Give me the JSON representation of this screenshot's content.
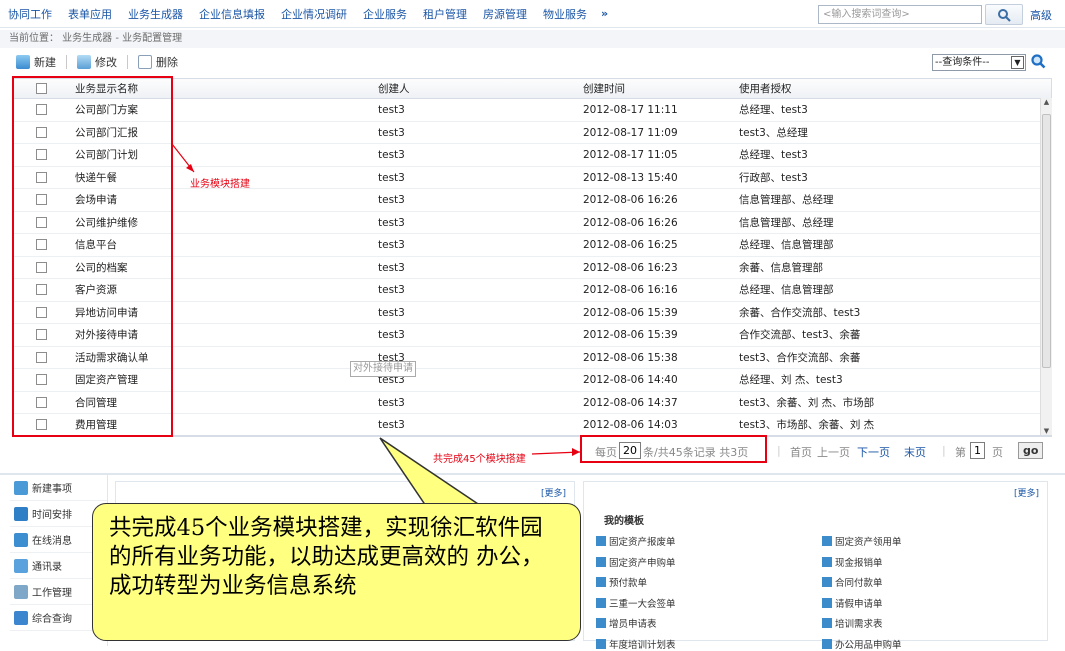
{
  "topnav": {
    "items": [
      "协同工作",
      "表单应用",
      "业务生成器",
      "企业信息填报",
      "企业情况调研",
      "企业服务",
      "租户管理",
      "房源管理",
      "物业服务"
    ],
    "more": "»",
    "search_placeholder": "<输入搜索词查询>",
    "advanced": "高级"
  },
  "breadcrumb": "当前位置： 业务生成器 - 业务配置管理",
  "toolbar": {
    "new": "新建",
    "edit": "修改",
    "delete": "删除",
    "query_select": "--查询条件--"
  },
  "grid": {
    "columns": [
      "业务显示名称",
      "创建人",
      "创建时间",
      "使用者授权"
    ],
    "rows": [
      [
        "公司部门方案",
        "test3",
        "2012-08-17 11:11",
        "总经理、test3"
      ],
      [
        "公司部门汇报",
        "test3",
        "2012-08-17 11:09",
        "test3、总经理"
      ],
      [
        "公司部门计划",
        "test3",
        "2012-08-17 11:05",
        "总经理、test3"
      ],
      [
        "快递午餐",
        "test3",
        "2012-08-13 15:40",
        "行政部、test3"
      ],
      [
        "会场申请",
        "test3",
        "2012-08-06 16:26",
        "信息管理部、总经理"
      ],
      [
        "公司维护维修",
        "test3",
        "2012-08-06 16:26",
        "信息管理部、总经理"
      ],
      [
        "信息平台",
        "test3",
        "2012-08-06 16:25",
        "总经理、信息管理部"
      ],
      [
        "公司的档案",
        "test3",
        "2012-08-06 16:23",
        "余蕃、信息管理部"
      ],
      [
        "客户资源",
        "test3",
        "2012-08-06 16:16",
        "总经理、信息管理部"
      ],
      [
        "异地访问申请",
        "test3",
        "2012-08-06 15:39",
        "余蕃、合作交流部、test3"
      ],
      [
        "对外接待申请",
        "test3",
        "2012-08-06 15:39",
        "合作交流部、test3、余蕃"
      ],
      [
        "活动需求确认单",
        "test3",
        "2012-08-06 15:38",
        "test3、合作交流部、余蕃"
      ],
      [
        "固定资产管理",
        "test3",
        "2012-08-06 14:40",
        "总经理、刘 杰、test3"
      ],
      [
        "合同管理",
        "test3",
        "2012-08-06 14:37",
        "test3、余蕃、刘 杰、市场部"
      ],
      [
        "费用管理",
        "test3",
        "2012-08-06 14:03",
        "test3、市场部、余蕃、刘 杰"
      ]
    ],
    "tooltip": "对外接待申请"
  },
  "pager": {
    "per_page_prefix": "每页",
    "per_page": "20",
    "summary": "条/共45条记录  共3页",
    "first": "首页",
    "prev": "上一页",
    "next": "下一页",
    "last": "末页",
    "page_prefix": "第",
    "page": "1",
    "page_suffix": "页",
    "go": "go"
  },
  "annotations": {
    "module_build": "业务模块搭建",
    "total_built": "共完成45个模块搭建",
    "callout": "共完成45个业务模块搭建，实现徐汇软件园的所有业务功能，以助达成更高效的 办公，成功转型为业务信息系统"
  },
  "bottom": {
    "nav": [
      "新建事项",
      "时间安排",
      "在线消息",
      "通讯录",
      "工作管理",
      "综合查询"
    ],
    "more": "[更多]",
    "templates_title": "我的模板",
    "templates_left": [
      "固定资产报废单",
      "固定资产申购单",
      "预付款单",
      "三重一大会签单",
      "增员申请表",
      "年度培训计划表"
    ],
    "templates_right": [
      "固定资产领用单",
      "现金报销单",
      "合同付款单",
      "请假申请单",
      "培训需求表",
      "办公用品申购单"
    ]
  },
  "colors": {
    "link": "#1a56a6",
    "highlight_red": "#e60012",
    "callout_bg": "#ffff80"
  }
}
